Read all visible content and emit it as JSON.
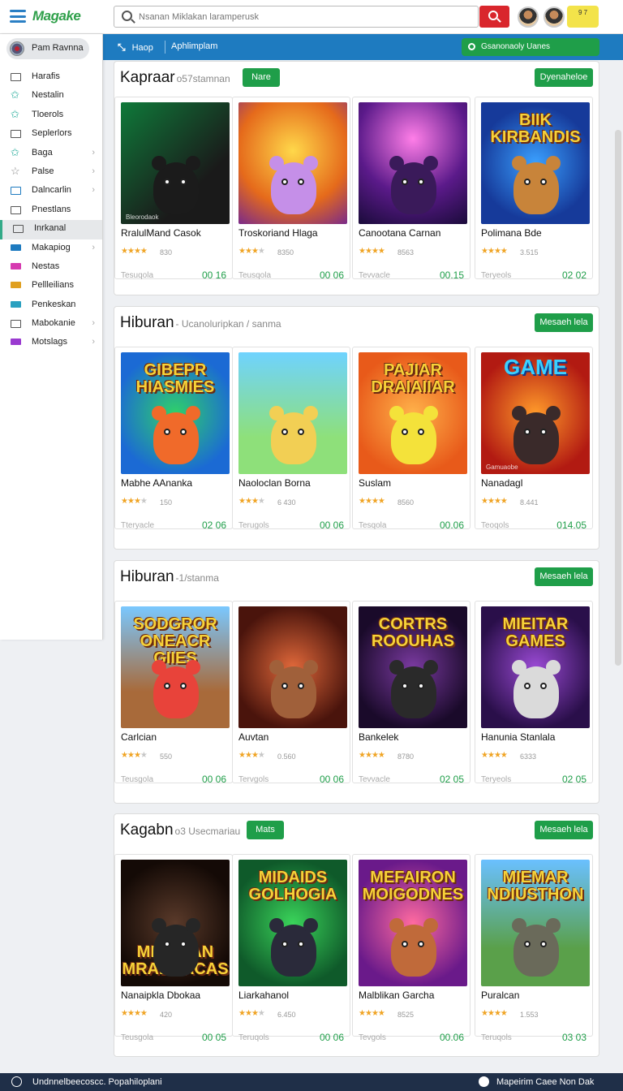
{
  "header": {
    "logo": "Magake",
    "search_placeholder": "Nsanan Miklakan laramperusk",
    "notif_text": "9 7"
  },
  "nav": {
    "home": "Haop",
    "link": "Aphlimplam",
    "green_button": "Gsanonaoly Uanes"
  },
  "sidebar": {
    "user": "Pam Ravnna",
    "items": [
      {
        "label": "Harafis",
        "icon": "box-icon",
        "chevron": false
      },
      {
        "label": "Nestalin",
        "icon": "star-icon",
        "chevron": false
      },
      {
        "label": "Tloerols",
        "icon": "star-icon",
        "chevron": false
      },
      {
        "label": "Seplerlors",
        "icon": "box-icon",
        "chevron": false
      },
      {
        "label": "Baga",
        "icon": "star-icon",
        "chevron": true
      },
      {
        "label": "Palse",
        "icon": "star-outline-icon",
        "chevron": true
      },
      {
        "label": "Dalncarlin",
        "icon": "box-icon",
        "chevron": true
      },
      {
        "label": "Pnestlans",
        "icon": "chart-icon",
        "chevron": false
      },
      {
        "label": "Inrkanal",
        "icon": "box-icon",
        "chevron": false,
        "active": true
      },
      {
        "label": "Makapiog",
        "icon": "box-icon",
        "chevron": true
      },
      {
        "label": "Nestas",
        "icon": "box-icon",
        "chevron": false
      },
      {
        "label": "Pellleilians",
        "icon": "box-icon",
        "chevron": false
      },
      {
        "label": "Penkeskan",
        "icon": "box-icon",
        "chevron": false
      },
      {
        "label": "Mabokanie",
        "icon": "chart-icon",
        "chevron": true
      },
      {
        "label": "Motslags",
        "icon": "box-icon",
        "chevron": true
      }
    ]
  },
  "sections": [
    {
      "title": "Kapraar",
      "subtitle": "o57stamnan",
      "badge": "Nare",
      "more": "Dyenaheloe",
      "games": [
        {
          "name": "RralulMand Casok",
          "stars": 4,
          "rating": "830",
          "free": "Tesuqola",
          "num": "00 16"
        },
        {
          "name": "Troskoriand Hlaga",
          "stars": 3,
          "rating": "8350",
          "free": "Teusqola",
          "num": "00 06"
        },
        {
          "name": "Canootana Carnan",
          "stars": 4,
          "rating": "8563",
          "free": "Tevvacle",
          "num": "00.15"
        },
        {
          "name": "Polimana Bde",
          "stars": 4,
          "rating": "3.515",
          "free": "Teryeols",
          "num": "02 02"
        }
      ]
    },
    {
      "title": "Hiburan",
      "subtitle": "- Ucanoluripkan / sanma",
      "badge": "",
      "more": "Mesaeh lela",
      "games": [
        {
          "name": "Mabhe AAnanka",
          "stars": 3,
          "rating": "150",
          "free": "Tteryacle",
          "num": "02 06"
        },
        {
          "name": "Naoloclan Borna",
          "stars": 3,
          "rating": "6 430",
          "free": "Terugols",
          "num": "00 06"
        },
        {
          "name": "Suslam",
          "stars": 4,
          "rating": "8560",
          "free": "Tesqola",
          "num": "00.06"
        },
        {
          "name": "Nanadagl",
          "stars": 4,
          "rating": "8.441",
          "free": "Teoqols",
          "num": "014.05"
        }
      ]
    },
    {
      "title": "Hiburan",
      "subtitle": "-1/stanma",
      "badge": "",
      "more": "Mesaeh lela",
      "games": [
        {
          "name": "Carlcian",
          "stars": 3,
          "rating": "550",
          "free": "Teusgola",
          "num": "00 06"
        },
        {
          "name": "Auvtan",
          "stars": 3,
          "rating": "0.560",
          "free": "Tervgols",
          "num": "00 06"
        },
        {
          "name": "Bankelek",
          "stars": 4,
          "rating": "8780",
          "free": "Tevvacle",
          "num": "02 05"
        },
        {
          "name": "Hanunia Stanlala",
          "stars": 4,
          "rating": "6333",
          "free": "Teryeols",
          "num": "02 05"
        }
      ]
    },
    {
      "title": "Kagabn",
      "subtitle": "o3 Usecmariau",
      "badge": "Mats",
      "more": "Mesaeh lela",
      "games": [
        {
          "name": "Nanaipkla Dbokaa",
          "stars": 4,
          "rating": "420",
          "free": "Teusgola",
          "num": "00 05"
        },
        {
          "name": "Liarkahanol",
          "stars": 3,
          "rating": "6.450",
          "free": "Teruqols",
          "num": "00 06"
        },
        {
          "name": "Malblikan Garcha",
          "stars": 4,
          "rating": "8525",
          "free": "Tevgols",
          "num": "00.06"
        },
        {
          "name": "Puralcan",
          "stars": 4,
          "rating": "1.553",
          "free": "Teruqols",
          "num": "03 03"
        }
      ]
    }
  ],
  "thumbs": [
    {
      "title": "",
      "footer": "Bleorodaok",
      "bg": "linear-gradient(135deg,#0f7a3a,#1a1a1a 70%)",
      "char": "#1b1b1b"
    },
    {
      "title": "",
      "footer": "",
      "bg": "radial-gradient(circle at 50% 40%,#ffd84a,#e56a1b 60%,#7a2a8a)",
      "char": "#c58fe8"
    },
    {
      "title": "",
      "footer": "",
      "bg": "radial-gradient(circle at 50% 30%,#ff7ee8,#5b1a8a 55%,#1a0b3a)",
      "char": "#3a1a5a"
    },
    {
      "title": "BIIK KIRBANDIS",
      "footer": "",
      "bg": "radial-gradient(circle,#3aa0ff,#163a9a 70%)",
      "char": "#c8843a"
    },
    {
      "title": "GIBEPR HIASMIES",
      "footer": "",
      "bg": "radial-gradient(circle,#2fd06a,#1b6ad4 75%)",
      "char": "#f06a2a"
    },
    {
      "title": "",
      "footer": "",
      "bg": "linear-gradient(180deg,#6fd3ff,#8ee07a 70%)",
      "char": "#f2cf54"
    },
    {
      "title": "PAJIAR DRAIAIIAR",
      "footer": "",
      "bg": "radial-gradient(circle,#ffb24a,#e85a1a 75%)",
      "char": "#f4e23a"
    },
    {
      "title": "GAME",
      "footer": "Gamuaobe",
      "bg": "radial-gradient(circle,#ff9a2a,#b21a12 75%)",
      "char": "#3a2a2a"
    },
    {
      "title": "SODGROR ONEACR GIIES",
      "footer": "",
      "bg": "linear-gradient(180deg,#7ac8ff,#a86a3a 70%)",
      "char": "#e8433a"
    },
    {
      "title": "",
      "footer": "",
      "bg": "radial-gradient(circle,#e0683a,#4a140c 75%)",
      "char": "#a0603a"
    },
    {
      "title": "CORTRS ROOUHAS",
      "footer": "",
      "bg": "radial-gradient(circle,#7a3aa0,#1a0a2a 75%)",
      "char": "#2a2a2a"
    },
    {
      "title": "MIEITAR GAMES",
      "footer": "",
      "bg": "radial-gradient(circle,#9a4ad4,#2a0f4a 75%)",
      "char": "#dadada"
    },
    {
      "title": "MIHARAN MRADHACAS",
      "footer": "",
      "bg": "radial-gradient(circle,#5a3a2a,#140a06 75%)",
      "char": "#262626"
    },
    {
      "title": "MIDAIDS GOLHOGIA",
      "footer": "",
      "bg": "radial-gradient(circle,#3ad45a,#0f5a2a 75%)",
      "char": "#2a2a3a"
    },
    {
      "title": "MEFAIRON MOIGODNES",
      "footer": "",
      "bg": "radial-gradient(circle,#ff6aa0,#6a1a8a 75%)",
      "char": "#c06a3a"
    },
    {
      "title": "MIEMAR NDIUSTHON",
      "footer": "",
      "bg": "linear-gradient(180deg,#6ac0ff,#5aa04a 70%)",
      "char": "#6a6a5a"
    }
  ],
  "footer": {
    "left": "Undnnelbeecoscc. Popahiloplani",
    "right": "Mapeirim Caee Non Dak"
  },
  "colors": {
    "accent": "#1e7bc0",
    "green": "#1f9e49",
    "red": "#d9262c",
    "star": "#f0a424"
  }
}
